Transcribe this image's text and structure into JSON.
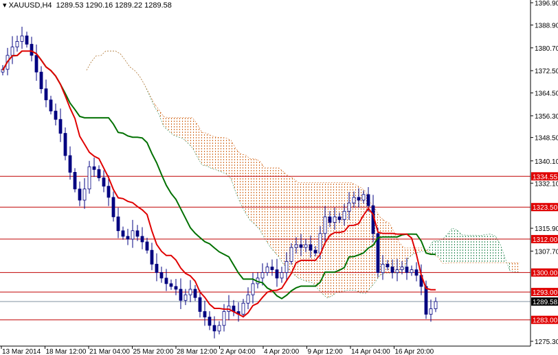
{
  "header": {
    "symbol": "XAUUSD,H4",
    "ohlc": "1289.53 1290.16 1289.22 1289.58"
  },
  "chart_data": {
    "type": "candlestick",
    "symbol": "XAUUSD",
    "timeframe": "H4",
    "ylim": [
      1275.3,
      1396.9
    ],
    "y_ticks": [
      "1396.90",
      "1388.90",
      "1380.70",
      "1372.50",
      "1364.50",
      "1356.30",
      "1348.50",
      "1340.10",
      "1332.10",
      "1315.90",
      "1307.70",
      "1275.30"
    ],
    "x_ticks": [
      "13 Mar 2014",
      "18 Mar 12:00",
      "21 Mar 04:00",
      "25 Mar 20:00",
      "28 Mar 12:00",
      "2 Apr 04:00",
      "4 Apr 20:00",
      "9 Apr 12:00",
      "14 Apr 04:00",
      "16 Apr 20:00"
    ],
    "closes": [
      1373,
      1378,
      1381,
      1383,
      1385,
      1382,
      1378,
      1372,
      1366,
      1362,
      1358,
      1355,
      1350,
      1342,
      1336,
      1330,
      1326,
      1330,
      1338,
      1337,
      1334,
      1331,
      1327,
      1320,
      1315,
      1313,
      1312,
      1315,
      1313,
      1311,
      1308,
      1303,
      1300,
      1298,
      1296,
      1295,
      1294,
      1290,
      1292,
      1294,
      1291,
      1286,
      1284,
      1281,
      1279,
      1281,
      1286,
      1288,
      1286,
      1285,
      1289,
      1292,
      1296,
      1298,
      1300,
      1302,
      1301,
      1298,
      1300,
      1304,
      1309,
      1310,
      1309,
      1310,
      1308,
      1307,
      1314,
      1320,
      1318,
      1320,
      1319,
      1322,
      1325,
      1327,
      1326,
      1328,
      1324,
      1314,
      1300,
      1303,
      1302,
      1300,
      1301,
      1302,
      1300,
      1301,
      1299,
      1295,
      1285,
      1287,
      1289.58
    ],
    "levels": [
      {
        "price": 1334.55,
        "label": "1334.55"
      },
      {
        "price": 1323.5,
        "label": "1323.50"
      },
      {
        "price": 1312.0,
        "label": "1312.00"
      },
      {
        "price": 1300.0,
        "label": "1300.00"
      },
      {
        "price": 1293.0,
        "label": "1293.00"
      },
      {
        "price": 1283.0,
        "label": "1283.00"
      }
    ],
    "current_price": {
      "price": 1289.58,
      "label": "1289.58"
    },
    "indicators": [
      "Tenkan-sen",
      "Kijun-sen",
      "Kumo cloud"
    ],
    "colors": {
      "tenkan": "#e00000",
      "kijun": "#007000",
      "bull_cloud": "#2e8b57",
      "bear_cloud": "#d2691e",
      "level": "#c00000",
      "candle": "#000080"
    }
  }
}
